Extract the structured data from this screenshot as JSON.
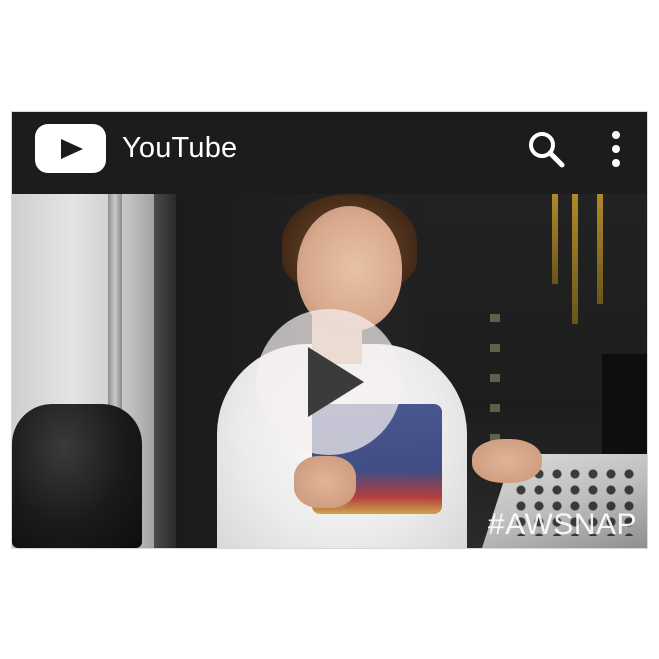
{
  "app": {
    "title": "YouTube",
    "logo_icon": "youtube-play-logo-icon",
    "search_icon": "search-icon",
    "menu_icon": "more-vert-icon",
    "bar_color": "#1c1c1c"
  },
  "video": {
    "overlay_text": "#AWSNAP",
    "play_icon": "play-icon",
    "play_button_color": "#f5f0f0"
  }
}
